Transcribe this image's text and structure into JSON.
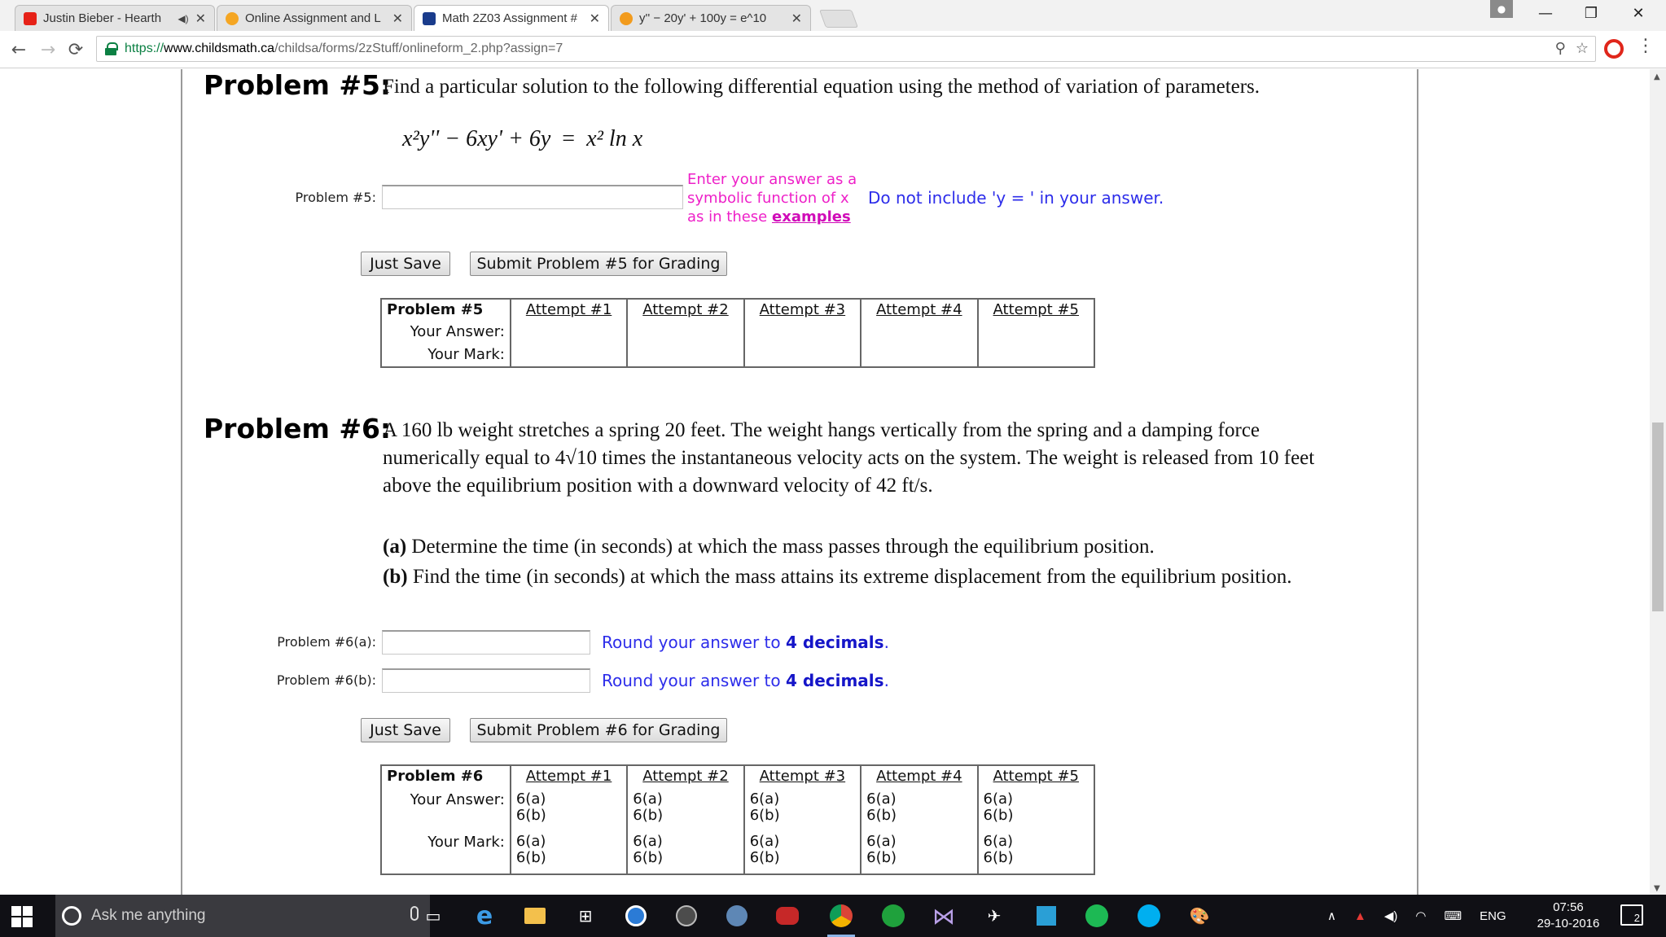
{
  "browser": {
    "tabs": [
      {
        "title": "Justin Bieber - Hearth",
        "favicon_color": "#e62117",
        "active": false
      },
      {
        "title": "Online Assignment and L",
        "favicon_color": "#f5a623",
        "active": false
      },
      {
        "title": "Math 2Z03 Assignment #",
        "favicon_color": "#1a3c8c",
        "active": true
      },
      {
        "title": "y'' − 20y' + 100y = e^10",
        "favicon_color": "#f29b1d",
        "active": false
      }
    ],
    "url": {
      "scheme": "https://",
      "host": "www.childsmath.ca",
      "path": "/childsa/forms/2zStuff/onlineform_2.php?assign=7"
    }
  },
  "problem5": {
    "heading": "Problem #5:",
    "text": "Find a particular solution to the following differential equation using the method of variation of parameters.",
    "equation_lhs": "x²y'' − 6xy' + 6y",
    "equation_eq": "=",
    "equation_rhs": "x² ln x",
    "field_label": "Problem #5:",
    "input_value": "",
    "hint_line1": "Enter your answer as a",
    "hint_line2": "symbolic function of x",
    "hint_line3": "as in these",
    "hint_link": "examples",
    "note": "Do not include 'y = ' in your answer.",
    "save_button": "Just Save",
    "submit_button": "Submit Problem #5 for Grading",
    "table": {
      "header": "Problem #5",
      "attempts": [
        "Attempt #1",
        "Attempt #2",
        "Attempt #3",
        "Attempt #4",
        "Attempt #5"
      ],
      "row_answer": "Your Answer:",
      "row_mark": "Your Mark:"
    }
  },
  "problem6": {
    "heading": "Problem #6:",
    "text_line1": "A 160 lb weight stretches a spring 20 feet. The weight hangs vertically from the spring and a damping force",
    "text_line2": "numerically equal to 4√10 times the instantaneous velocity acts on the system. The weight is released from 10 feet",
    "text_line3": "above the equilibrium position with a downward velocity of 42 ft/s.",
    "part_a_label": "(a)",
    "part_a_text": "Determine the time (in seconds) at which the mass passes through the equilibrium position.",
    "part_b_label": "(b)",
    "part_b_text": "Find the time (in seconds) at which the mass attains its extreme displacement from the equilibrium position.",
    "field_a_label": "Problem #6(a):",
    "field_b_label": "Problem #6(b):",
    "input_a_value": "",
    "input_b_value": "",
    "round_prefix": "Round your answer to",
    "round_bold": "4 decimals",
    "round_suffix": ".",
    "save_button": "Just Save",
    "submit_button": "Submit Problem #6 for Grading",
    "table": {
      "header": "Problem #6",
      "attempts": [
        "Attempt #1",
        "Attempt #2",
        "Attempt #3",
        "Attempt #4",
        "Attempt #5"
      ],
      "row_answer": "Your Answer:",
      "row_mark": "Your Mark:",
      "sub_a": "6(a)",
      "sub_b": "6(b)"
    }
  },
  "taskbar": {
    "search_placeholder": "Ask me anything",
    "language": "ENG",
    "time": "07:56",
    "date": "29-10-2016",
    "notification_count": "2"
  }
}
